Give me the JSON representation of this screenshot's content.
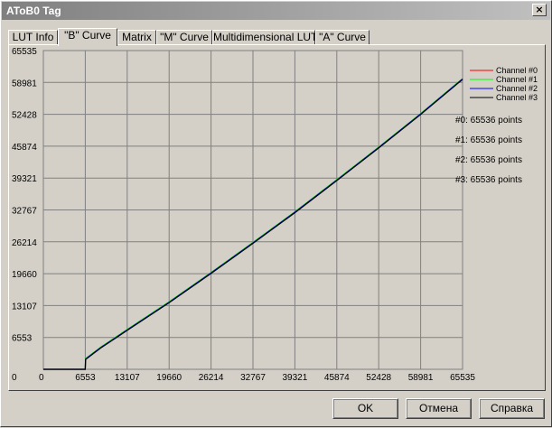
{
  "window": {
    "title": "AToB0 Tag",
    "close_glyph": "×"
  },
  "tabs": [
    {
      "label": "LUT Info",
      "active": false
    },
    {
      "label": "\"B\" Curve",
      "active": true
    },
    {
      "label": "Matrix",
      "active": false
    },
    {
      "label": "\"M\" Curve",
      "active": false
    },
    {
      "label": "Multidimensional LUT",
      "active": false
    },
    {
      "label": "\"A\" Curve",
      "active": false
    }
  ],
  "chart_data": {
    "type": "line",
    "xlim": [
      0,
      65535
    ],
    "ylim": [
      0,
      65535
    ],
    "x_ticks": [
      "0",
      "6553",
      "13107",
      "19660",
      "26214",
      "32767",
      "39321",
      "45874",
      "52428",
      "58981",
      "65535"
    ],
    "y_ticks": [
      "0",
      "6553",
      "13107",
      "19660",
      "26214",
      "32767",
      "39321",
      "45874",
      "52428",
      "58981",
      "65535"
    ],
    "grid": true,
    "legend_position": "right",
    "series": [
      {
        "name": "Channel #0",
        "color": "#ff0000",
        "points_label": "#0: 65536 points",
        "x": [
          0,
          6553,
          6600,
          9000,
          13107,
          19660,
          26214,
          32767,
          39321,
          45874,
          52428,
          58981,
          65535
        ],
        "y": [
          0,
          0,
          2100,
          4500,
          8100,
          13800,
          19800,
          26000,
          32300,
          38900,
          45600,
          52500,
          59700
        ]
      },
      {
        "name": "Channel #1",
        "color": "#00ff00",
        "points_label": "#1: 65536 points",
        "x": [
          0,
          6553,
          6600,
          9000,
          13107,
          19660,
          26214,
          32767,
          39321,
          45874,
          52428,
          58981,
          65535
        ],
        "y": [
          0,
          0,
          2200,
          4600,
          8200,
          13900,
          19900,
          26100,
          32400,
          39000,
          45700,
          52600,
          59800
        ]
      },
      {
        "name": "Channel #2",
        "color": "#0000ff",
        "points_label": "#2: 65536 points",
        "x": [
          0,
          6553,
          6600,
          9000,
          13107,
          19660,
          26214,
          32767,
          39321,
          45874,
          52428,
          58981,
          65535
        ],
        "y": [
          0,
          0,
          2100,
          4500,
          8100,
          13800,
          19800,
          26000,
          32300,
          38900,
          45600,
          52500,
          59700
        ]
      },
      {
        "name": "Channel #3",
        "color": "#000000",
        "points_label": "#3: 65536 points",
        "x": [
          0,
          6553,
          6600,
          9000,
          13107,
          19660,
          26214,
          32767,
          39321,
          45874,
          52428,
          58981,
          65535
        ],
        "y": [
          0,
          0,
          2000,
          4400,
          8000,
          13700,
          19700,
          25900,
          32200,
          38800,
          45500,
          52400,
          59600
        ]
      }
    ]
  },
  "buttons": {
    "ok": "OK",
    "cancel": "Отмена",
    "help": "Справка"
  }
}
